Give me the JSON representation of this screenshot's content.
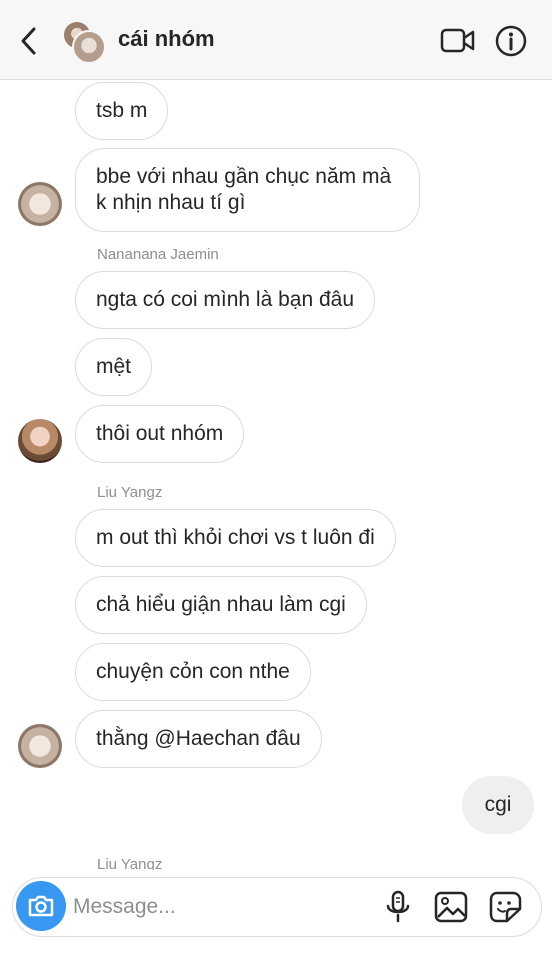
{
  "header": {
    "title": "cái nhóm",
    "back_icon": "chevron-left-icon",
    "video_icon": "video-camera-icon",
    "info_icon": "info-icon"
  },
  "messages": [
    {
      "text": "tsb m"
    },
    {
      "text": "bbe với nhau gần chục năm mà k nhịn nhau tí gì"
    },
    {
      "sender": "Nananana Jaemin"
    },
    {
      "text": "ngta có coi mình là bạn đâu"
    },
    {
      "text": "mệt"
    },
    {
      "text": "thôi out nhóm"
    },
    {
      "sender": "Liu Yangz"
    },
    {
      "text": "m out thì khỏi chơi vs t luôn đi"
    },
    {
      "text": "chả hiểu giận nhau làm cgi"
    },
    {
      "text": "chuyện cỏn con nthe"
    },
    {
      "text": "thằng @Haechan đâu"
    },
    {
      "own_text": "cgi"
    },
    {
      "sender": "Liu Yangz"
    }
  ],
  "composer": {
    "placeholder": "Message...",
    "value": "",
    "camera_icon": "camera-icon",
    "mic_icon": "microphone-icon",
    "gallery_icon": "gallery-icon",
    "sticker_icon": "sticker-icon",
    "accent_color": "#3897f0"
  }
}
